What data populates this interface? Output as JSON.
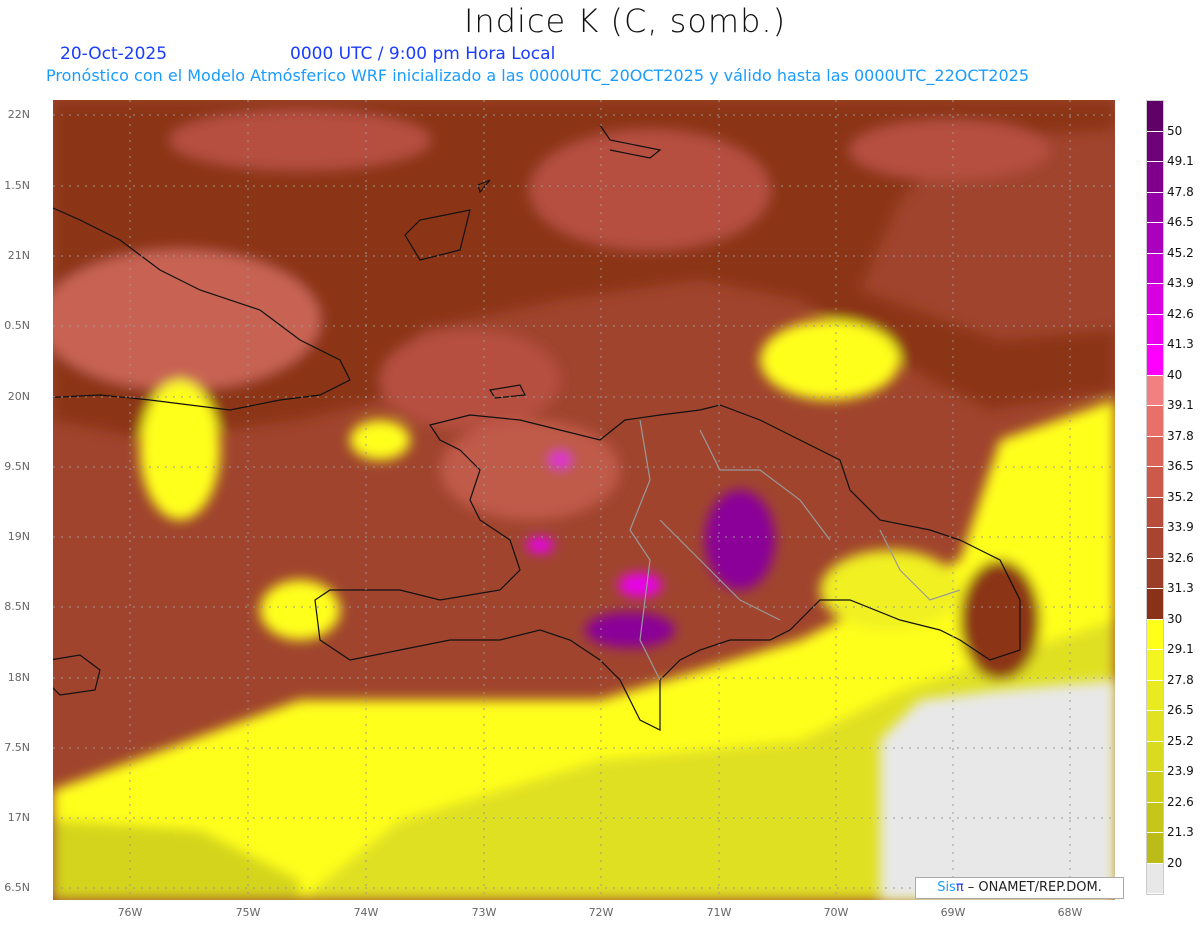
{
  "header": {
    "title": "Indice K (C, somb.)",
    "date": "20-Oct-2025",
    "time": "0000 UTC / 9:00 pm Hora Local",
    "info": "Pronóstico con el Modelo Atmósferico WRF inicializado a las 0000UTC_20OCT2025 y válido hasta las  0000UTC_22OCT2025"
  },
  "axes": {
    "lat_labels": [
      "22N",
      "1.5N",
      "21N",
      "0.5N",
      "20N",
      "9.5N",
      "19N",
      "8.5N",
      "18N",
      "7.5N",
      "17N",
      "6.5N"
    ],
    "lon_labels": [
      "76W",
      "75W",
      "74W",
      "73W",
      "72W",
      "71W",
      "70W",
      "69W",
      "68W"
    ]
  },
  "colorbar": {
    "labels": [
      "50",
      "49.1",
      "47.8",
      "46.5",
      "45.2",
      "43.9",
      "42.6",
      "41.3",
      "40",
      "39.1",
      "37.8",
      "36.5",
      "35.2",
      "33.9",
      "32.6",
      "31.3",
      "30",
      "29.1",
      "27.8",
      "26.5",
      "25.2",
      "23.9",
      "22.6",
      "21.3",
      "20"
    ],
    "colors": [
      "#5e0066",
      "#6e0078",
      "#80008c",
      "#9400a6",
      "#aa00be",
      "#c200d2",
      "#d800e0",
      "#ea00ee",
      "#ff00ff",
      "#f28080",
      "#e87068",
      "#da6458",
      "#cc5a4a",
      "#b84c3a",
      "#a84430",
      "#9a3e28",
      "#8a3218",
      "#ffff1a",
      "#f4f420",
      "#eaea20",
      "#e2e220",
      "#dada1e",
      "#d0d01c",
      "#c6c61a",
      "#bcbc18",
      "#e8e8e8"
    ]
  },
  "credit": {
    "brand_a": "Sis",
    "brand_b": "π",
    "text": " – ONAMET/REP.DOM."
  }
}
